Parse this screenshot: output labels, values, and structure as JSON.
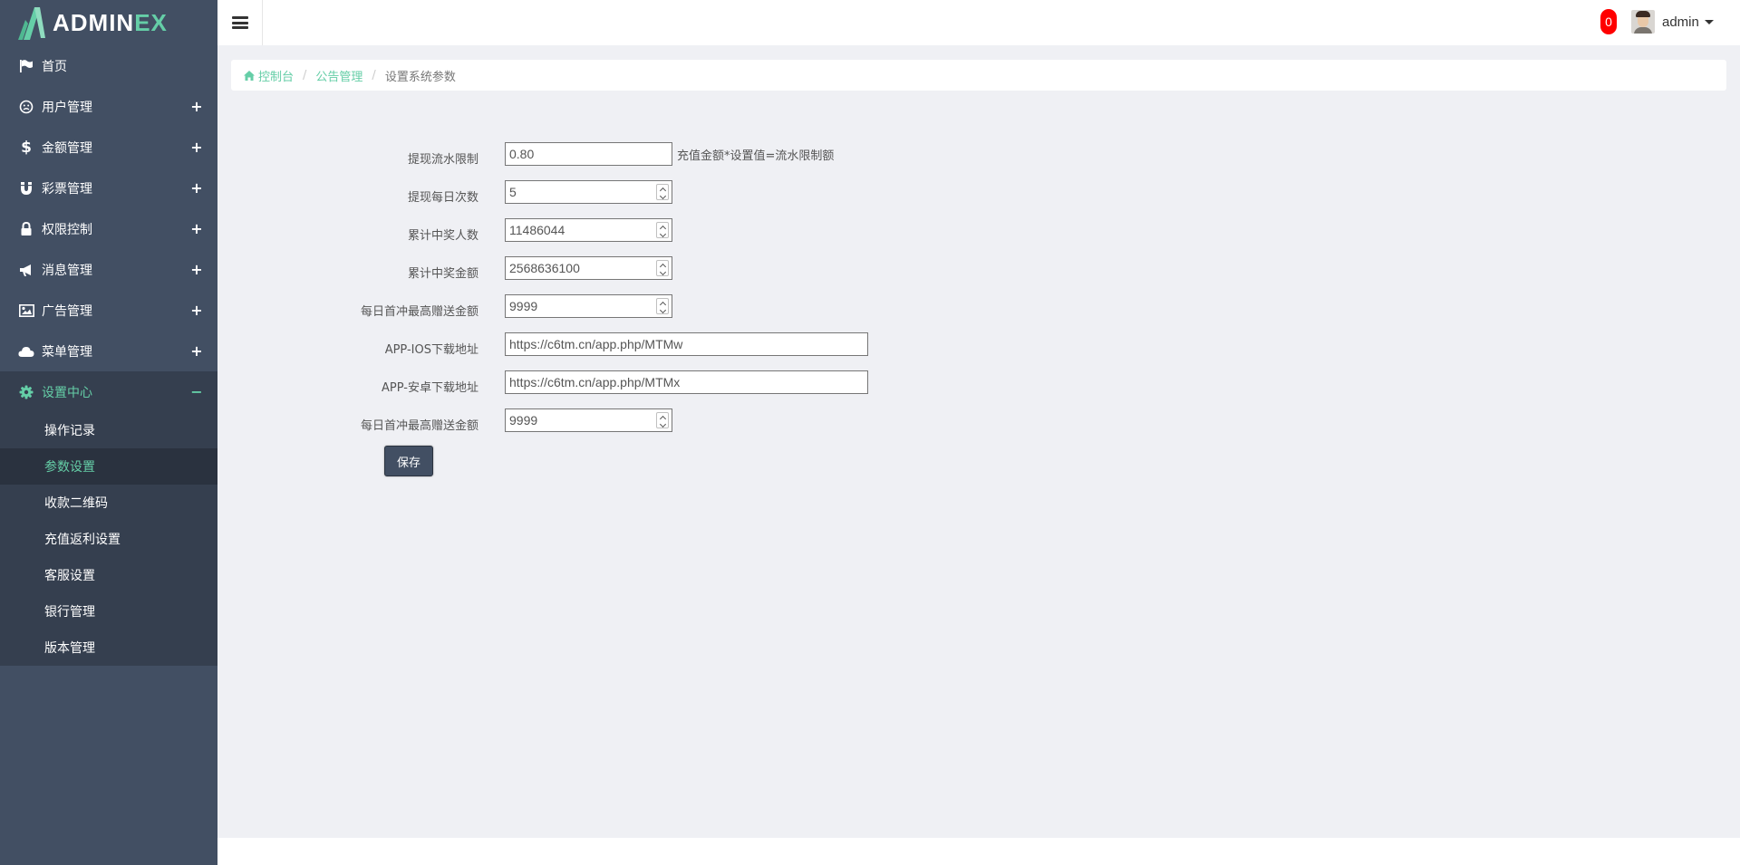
{
  "brand": {
    "name_white": "ADMIN",
    "name_green": "EX"
  },
  "header": {
    "notification_count": "0",
    "username": "admin"
  },
  "sidebar": {
    "items": [
      {
        "label": "首页",
        "icon": "flag-icon",
        "expandable": false
      },
      {
        "label": "用户管理",
        "icon": "smile-icon",
        "expandable": true
      },
      {
        "label": "金额管理",
        "icon": "dollar-icon",
        "expandable": true
      },
      {
        "label": "彩票管理",
        "icon": "magnet-icon",
        "expandable": true
      },
      {
        "label": "权限控制",
        "icon": "lock-icon",
        "expandable": true
      },
      {
        "label": "消息管理",
        "icon": "bullhorn-icon",
        "expandable": true
      },
      {
        "label": "广告管理",
        "icon": "picture-icon",
        "expandable": true
      },
      {
        "label": "菜单管理",
        "icon": "cloud-icon",
        "expandable": true
      },
      {
        "label": "设置中心",
        "icon": "gear-icon",
        "expandable": true,
        "expanded": true
      }
    ],
    "subitems": [
      {
        "label": "操作记录"
      },
      {
        "label": "参数设置",
        "current": true
      },
      {
        "label": "收款二维码"
      },
      {
        "label": "充值返利设置"
      },
      {
        "label": "客服设置"
      },
      {
        "label": "银行管理"
      },
      {
        "label": "版本管理"
      }
    ],
    "expand_symbol": "+",
    "collapse_symbol": "−"
  },
  "breadcrumb": {
    "home": "控制台",
    "section": "公告管理",
    "current": "设置系统参数",
    "separator": "/"
  },
  "form": {
    "fields": [
      {
        "label": "提现流水限制",
        "value": "0.80",
        "type": "text",
        "hint": "充值金额*设置值=流水限制额"
      },
      {
        "label": "提现每日次数",
        "value": "5",
        "type": "number"
      },
      {
        "label": "累计中奖人数",
        "value": "11486044",
        "type": "number"
      },
      {
        "label": "累计中奖金额",
        "value": "2568636100",
        "type": "number"
      },
      {
        "label": "每日首冲最高赠送金额",
        "value": "9999",
        "type": "number"
      },
      {
        "label": "APP-IOS下载地址",
        "value": "https://c6tm.cn/app.php/MTMw",
        "type": "url"
      },
      {
        "label": "APP-安卓下载地址",
        "value": "https://c6tm.cn/app.php/MTMx",
        "type": "url"
      },
      {
        "label": "每日首冲最高赠送金额",
        "value": "9999",
        "type": "number"
      }
    ],
    "save_label": "保存"
  },
  "colors": {
    "sidebar_bg": "#424f63",
    "sidebar_active_bg": "#353f4f",
    "accent": "#65cea7",
    "badge": "#ff0000",
    "content_bg": "#eff0f4"
  }
}
